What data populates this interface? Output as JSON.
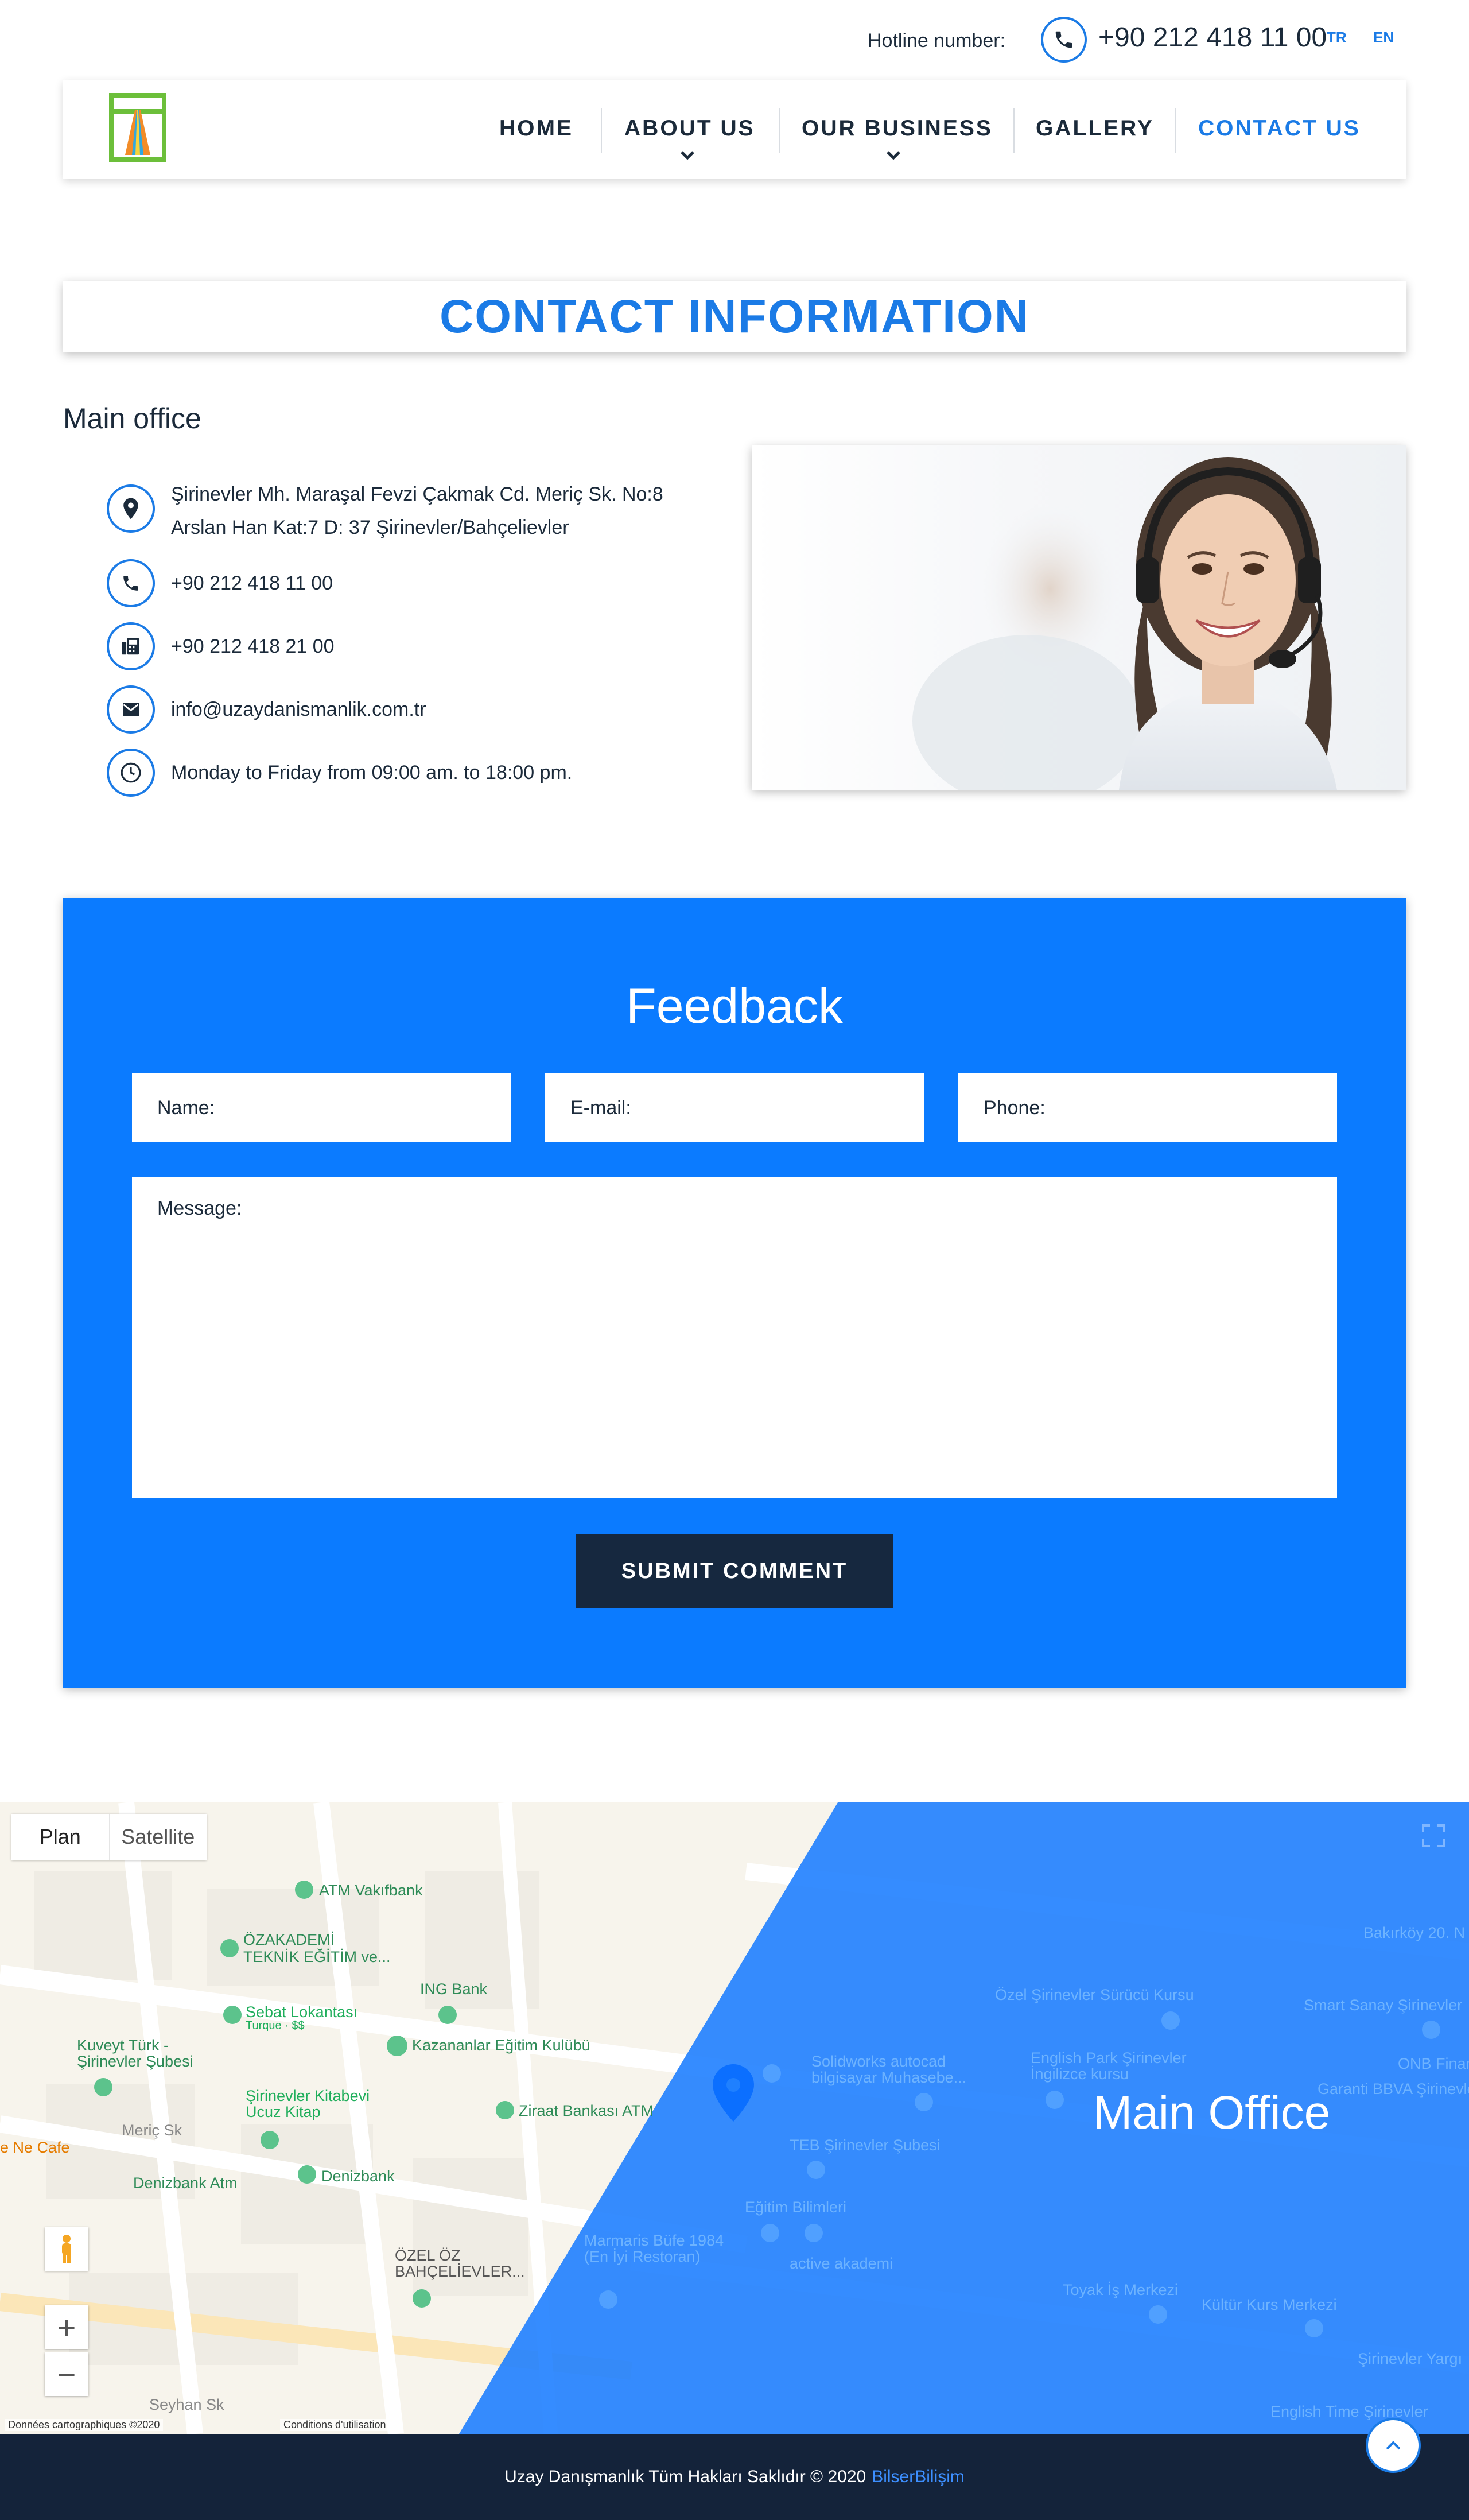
{
  "header": {
    "hotline_label": "Hotline number:",
    "hotline_number": "+90 212 418 11 00",
    "languages": [
      "TR",
      "EN"
    ]
  },
  "nav": {
    "items": [
      "HOME",
      "ABOUT US",
      "OUR BUSINESS",
      "GALLERY",
      "CONTACT US"
    ],
    "active": "CONTACT US"
  },
  "contact": {
    "title": "CONTACT INFORMATION",
    "office_title": "Main office",
    "address_line1": "Şirinevler Mh. Maraşal Fevzi Çakmak Cd. Meriç Sk. No:8",
    "address_line2": "Arslan Han Kat:7 D: 37 Şirinevler/Bahçelievler",
    "phone": "+90 212 418 11 00",
    "fax": "+90 212 418 21 00",
    "email": "info@uzaydanismanlik.com.tr",
    "hours": "Monday to Friday from 09:00 am. to 18:00 pm."
  },
  "feedback": {
    "title": "Feedback",
    "name_placeholder": "Name:",
    "email_placeholder": "E-mail:",
    "phone_placeholder": "Phone:",
    "message_placeholder": "Message:",
    "submit_label": "SUBMIT COMMENT"
  },
  "map": {
    "mode_plan": "Plan",
    "mode_satellite": "Satellite",
    "overlay_title": "Main Office",
    "zoom_in": "+",
    "zoom_out": "−",
    "attribution_data": "Données cartographiques ©2020",
    "attribution_terms": "Conditions d'utilisation",
    "labels": [
      {
        "text": "ATM Vakıfbank",
        "color": "#2e8b57"
      },
      {
        "text": "ÖZAKADEMİ",
        "color": "#2e8b57"
      },
      {
        "text": "TEKNİK EĞİTİM ve...",
        "color": "#2e8b57"
      },
      {
        "text": "ING Bank",
        "color": "#2e8b57"
      },
      {
        "text": "Sebat Lokantası",
        "color": "#1fae5b"
      },
      {
        "text": "Turque · $$",
        "color": "#1fae5b"
      },
      {
        "text": "Kazananlar Eğitim Kulübü",
        "color": "#2e8b57"
      },
      {
        "text": "Kuveyt Türk -",
        "color": "#2e8b57"
      },
      {
        "text": "Şirinevler Şubesi",
        "color": "#2e8b57"
      },
      {
        "text": "Şirinevler Kitabevi",
        "color": "#1fae5b"
      },
      {
        "text": "Ucuz Kitap",
        "color": "#1fae5b"
      },
      {
        "text": "Ziraat Bankası ATM",
        "color": "#2e8b57"
      },
      {
        "text": "e Ne Cafe",
        "color": "#e67c00"
      },
      {
        "text": "Meriç Sk",
        "color": "#888888"
      },
      {
        "text": "Denizbank Atm",
        "color": "#2e8b57"
      },
      {
        "text": "Denizbank",
        "color": "#2e8b57"
      },
      {
        "text": "ÖZEL ÖZ",
        "color": "#555555"
      },
      {
        "text": "BAHÇELİEVLER...",
        "color": "#555555"
      },
      {
        "text": "Seyhan Sk",
        "color": "#888888"
      },
      {
        "text": "Özel Şirinevler Sürücü Kursu",
        "color": "#2e8b57"
      },
      {
        "text": "Bakırköy 20. N",
        "color": "#555555"
      },
      {
        "text": "English Park Şirinevler",
        "color": "#2e8b57"
      },
      {
        "text": "İngilizce kursu",
        "color": "#2e8b57"
      },
      {
        "text": "Solidworks autocad",
        "color": "#2e8b57"
      },
      {
        "text": "bilgisayar Muhasebe...",
        "color": "#2e8b57"
      },
      {
        "text": "TEB Şirinevler Şubesi",
        "color": "#2e8b57"
      },
      {
        "text": "Eğitim Bilimleri",
        "color": "#2e8b57"
      },
      {
        "text": "Marmaris Büfe 1984",
        "color": "#e67c00"
      },
      {
        "text": "(En İyi Restoran)",
        "color": "#e67c00"
      },
      {
        "text": "active akademi",
        "color": "#2e8b57"
      },
      {
        "text": "Toyak İş Merkezi",
        "color": "#555555"
      },
      {
        "text": "Kültür Kurs Merkezi",
        "color": "#2e8b57"
      },
      {
        "text": "Şirinevler Yargı",
        "color": "#2e8b57"
      },
      {
        "text": "English Time Şirinevler",
        "color": "#2e8b57"
      },
      {
        "text": "Garanti BBVA Şirinevler",
        "color": "#2e8b57"
      },
      {
        "text": "ONB Finans",
        "color": "#2e8b57"
      },
      {
        "text": "Smart Sanay Şirinevler",
        "color": "#2e8b57"
      }
    ]
  },
  "footer": {
    "copyright": "Uzay Danışmanlık Tüm Hakları Saklıdır  © 2020",
    "link": "BilserBilişim"
  },
  "colors": {
    "accent": "#1b7be6",
    "feedback_bg": "#0b7bff",
    "dark": "#14233a"
  }
}
